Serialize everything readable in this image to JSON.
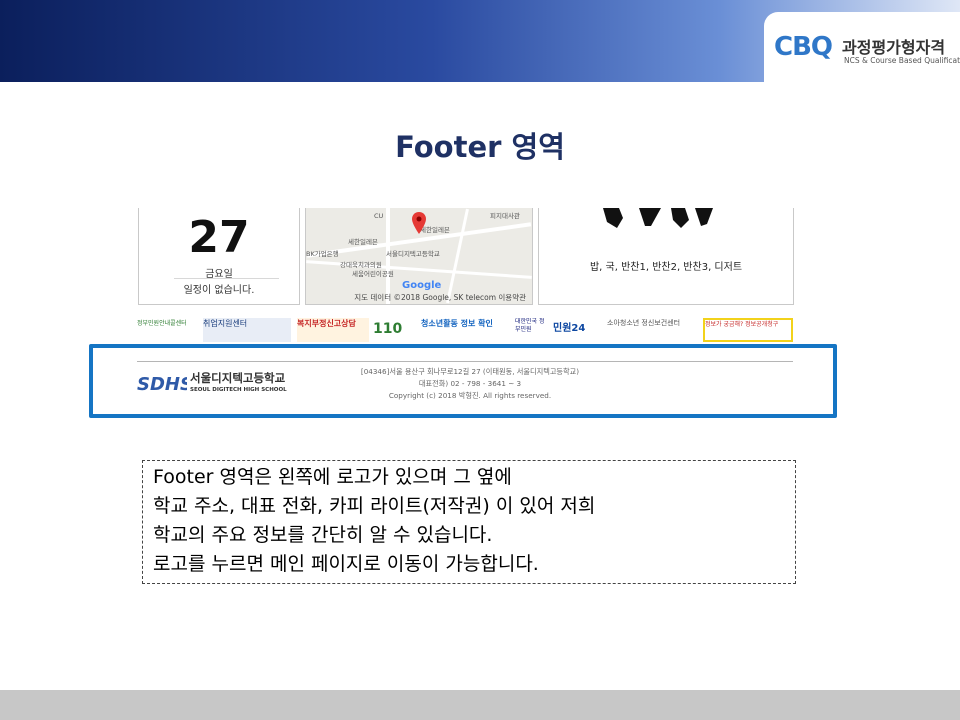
{
  "brand": {
    "logo_text": "CBQ",
    "title": "과정평가형자격",
    "subtitle": "NCS & Course Based Qualification"
  },
  "slide": {
    "title": "Footer 영역"
  },
  "screenshot": {
    "calendar": {
      "day": "27",
      "weekday": "금요일",
      "schedule": "일정이 없습니다."
    },
    "map": {
      "labels": [
        "피지대사관",
        "세한일레븐",
        "세한일레븐",
        "BK가업은행",
        "서울디지텍고등학교",
        "강대욱치과의원",
        "세움어린이공원",
        "CU"
      ],
      "google": "Google",
      "attribution": "지도 데이터 ©2018 Google, SK telecom   이용약관"
    },
    "meal": {
      "menu": "밥, 국, 반찬1, 반찬2, 반찬3, 디저트"
    },
    "banners": [
      "정부민원안내콜센터",
      "취업지원센터",
      "복지부정신고상담",
      "110",
      "청소년활동 정보 확인",
      "대한민국 정부민원",
      "민원24",
      "소아청소년 정신보건센터",
      "정보가 궁금해? 정보공개청구"
    ],
    "footer": {
      "logo_mark": "SDHS",
      "school_name": "서울디지텍고등학교",
      "school_name_en": "SEOUL DIGITECH HIGH SCHOOL",
      "address": "[04346]서울 용산구 회나무로12길 27 (이태원동, 서울디지텍고등학교)",
      "phone": "대표전화) 02 - 798 - 3641 ~ 3",
      "copyright": "Copyright (c) 2018 박형진. All rights reserved."
    }
  },
  "note": {
    "lines": [
      "Footer 영역은 왼쪽에 로고가 있으며 그 옆에",
      "학교 주소, 대표 전화, 카피 라이트(저작권) 이 있어 저희",
      "학교의 주요 정보를 간단히 알 수 있습니다.",
      "로고를 누르면 메인 페이지로 이동이 가능합니다."
    ]
  },
  "colors": {
    "title": "#1f3164",
    "highlight": "#1575c4",
    "header_dark": "#0b1f5c",
    "bottom_bar": "#c7c7c7"
  }
}
